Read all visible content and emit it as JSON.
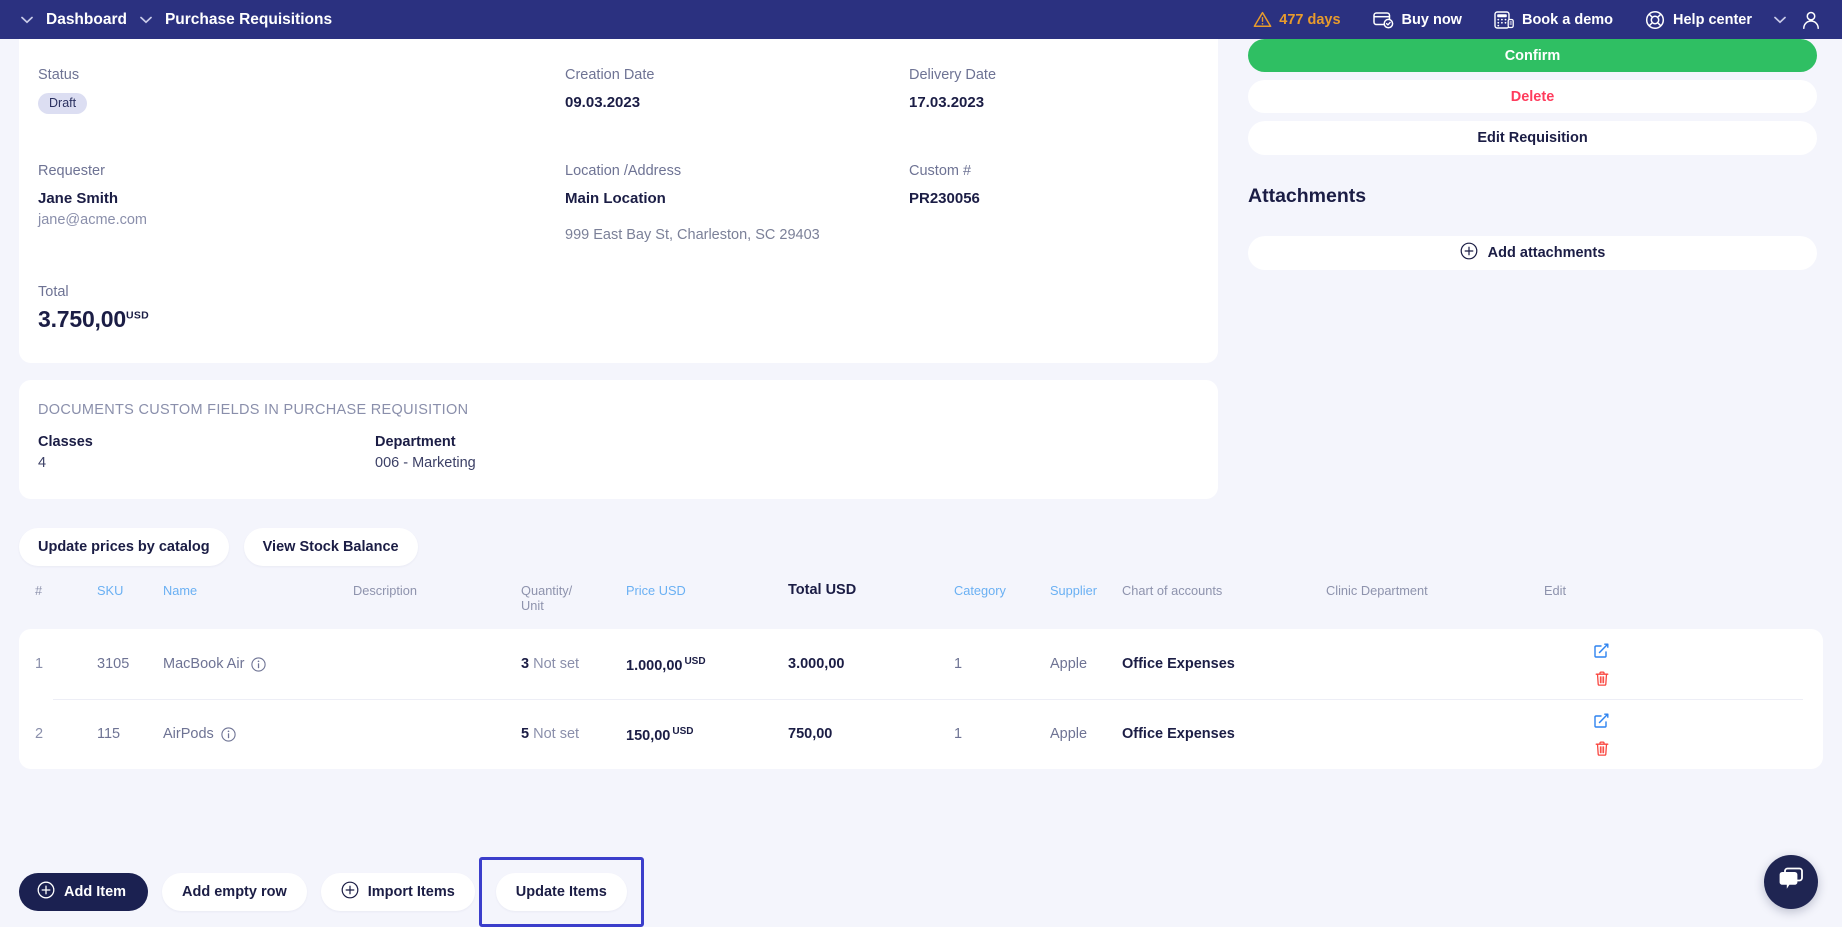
{
  "topnav": {
    "breadcrumbs": [
      {
        "label": "Dashboard",
        "icon": "chevron-down-icon"
      },
      {
        "label": "Purchase Requisitions",
        "icon": "chevron-down-icon"
      }
    ],
    "trial_days": "477 days",
    "trial_icon": "warning-triangle-icon",
    "buy_now": "Buy now",
    "buy_now_icon": "card-check-icon",
    "book_demo": "Book a demo",
    "book_demo_icon": "calculator-icon",
    "help_center": "Help center",
    "help_center_icon": "lifebuoy-icon",
    "user_caret_icon": "chevron-down-icon",
    "avatar_icon": "user-avatar-icon",
    "bg_color": "#2b3180",
    "warn_color": "#e89b2c"
  },
  "summary": {
    "status_label": "Status",
    "status_value": "Draft",
    "creation_date_label": "Creation Date",
    "creation_date_value": "09.03.2023",
    "delivery_date_label": "Delivery Date",
    "delivery_date_value": "17.03.2023",
    "requester_label": "Requester",
    "requester_name": "Jane Smith",
    "requester_email": "jane@acme.com",
    "location_label": "Location /Address",
    "location_value": "Main Location",
    "location_address": "999 East Bay St, Charleston, SC 29403",
    "custom_label": "Custom #",
    "custom_value": "PR230056",
    "total_label": "Total",
    "total_value": "3.750,00",
    "total_currency": "USD"
  },
  "custom_fields": {
    "section_title": "DOCUMENTS CUSTOM FIELDS IN PURCHASE REQUISITION",
    "fields": [
      {
        "label": "Classes",
        "value": "4"
      },
      {
        "label": "Department",
        "value": "006 - Marketing"
      }
    ]
  },
  "items_toolbar": {
    "update_prices": "Update prices by catalog",
    "view_stock": "View Stock Balance"
  },
  "table": {
    "headers": [
      {
        "label": "#",
        "style": "muted"
      },
      {
        "label": "SKU",
        "style": "link"
      },
      {
        "label": "Name",
        "style": "link"
      },
      {
        "label": "Description",
        "style": "muted"
      },
      {
        "label": "Quantity/\nUnit",
        "style": "muted"
      },
      {
        "label": "Price USD",
        "style": "link"
      },
      {
        "label": "Total USD",
        "style": "dark"
      },
      {
        "label": "Category",
        "style": "link"
      },
      {
        "label": "Supplier",
        "style": "link"
      },
      {
        "label": "Chart of accounts",
        "style": "muted"
      },
      {
        "label": "Clinic Department",
        "style": "muted"
      },
      {
        "label": "Edit",
        "style": "muted"
      }
    ],
    "header_labels": {
      "num": "#",
      "sku": "SKU",
      "name": "Name",
      "description": "Description",
      "quantity": "Quantity/",
      "quantity2": "Unit",
      "price": "Price USD",
      "total": "Total USD",
      "category": "Category",
      "supplier": "Supplier",
      "chart_of_accounts": "Chart of accounts",
      "clinic_department": "Clinic Department",
      "edit": "Edit"
    },
    "rows": [
      {
        "num": "1",
        "sku": "3105",
        "name": "MacBook Air",
        "name_info_icon": "info-circle-icon",
        "description": "",
        "qty": "3",
        "unit": "Not set",
        "price": "1.000,00",
        "price_currency": "USD",
        "total": "3.000,00",
        "category": "1",
        "supplier": "Apple",
        "chart_of_accounts": "Office Expenses",
        "clinic_department": "",
        "edit_icon": "edit-pencil-icon",
        "delete_icon": "trash-icon"
      },
      {
        "num": "2",
        "sku": "115",
        "name": "AirPods",
        "name_info_icon": "info-circle-icon",
        "description": "",
        "qty": "5",
        "unit": "Not set",
        "price": "150,00",
        "price_currency": "USD",
        "total": "750,00",
        "category": "1",
        "supplier": "Apple",
        "chart_of_accounts": "Office Expenses",
        "clinic_department": "",
        "edit_icon": "edit-pencil-icon",
        "delete_icon": "trash-icon"
      }
    ]
  },
  "bottom_actions": {
    "add_item": "Add Item",
    "add_item_icon": "plus-circle-icon",
    "add_empty_row": "Add empty row",
    "import_items": "Import Items",
    "import_items_icon": "plus-circle-icon",
    "update_items": "Update Items",
    "focus_color": "#3b3ecb"
  },
  "sidebar": {
    "confirm": "Confirm",
    "confirm_color": "#2fbf63",
    "delete": "Delete",
    "delete_color": "#ff3b5c",
    "edit_requisition": "Edit Requisition",
    "attachments_title": "Attachments",
    "add_attachments": "Add attachments",
    "add_attachments_icon": "plus-circle-icon"
  },
  "chat": {
    "icon": "chat-bubbles-icon",
    "bg_color": "#1f2552"
  }
}
